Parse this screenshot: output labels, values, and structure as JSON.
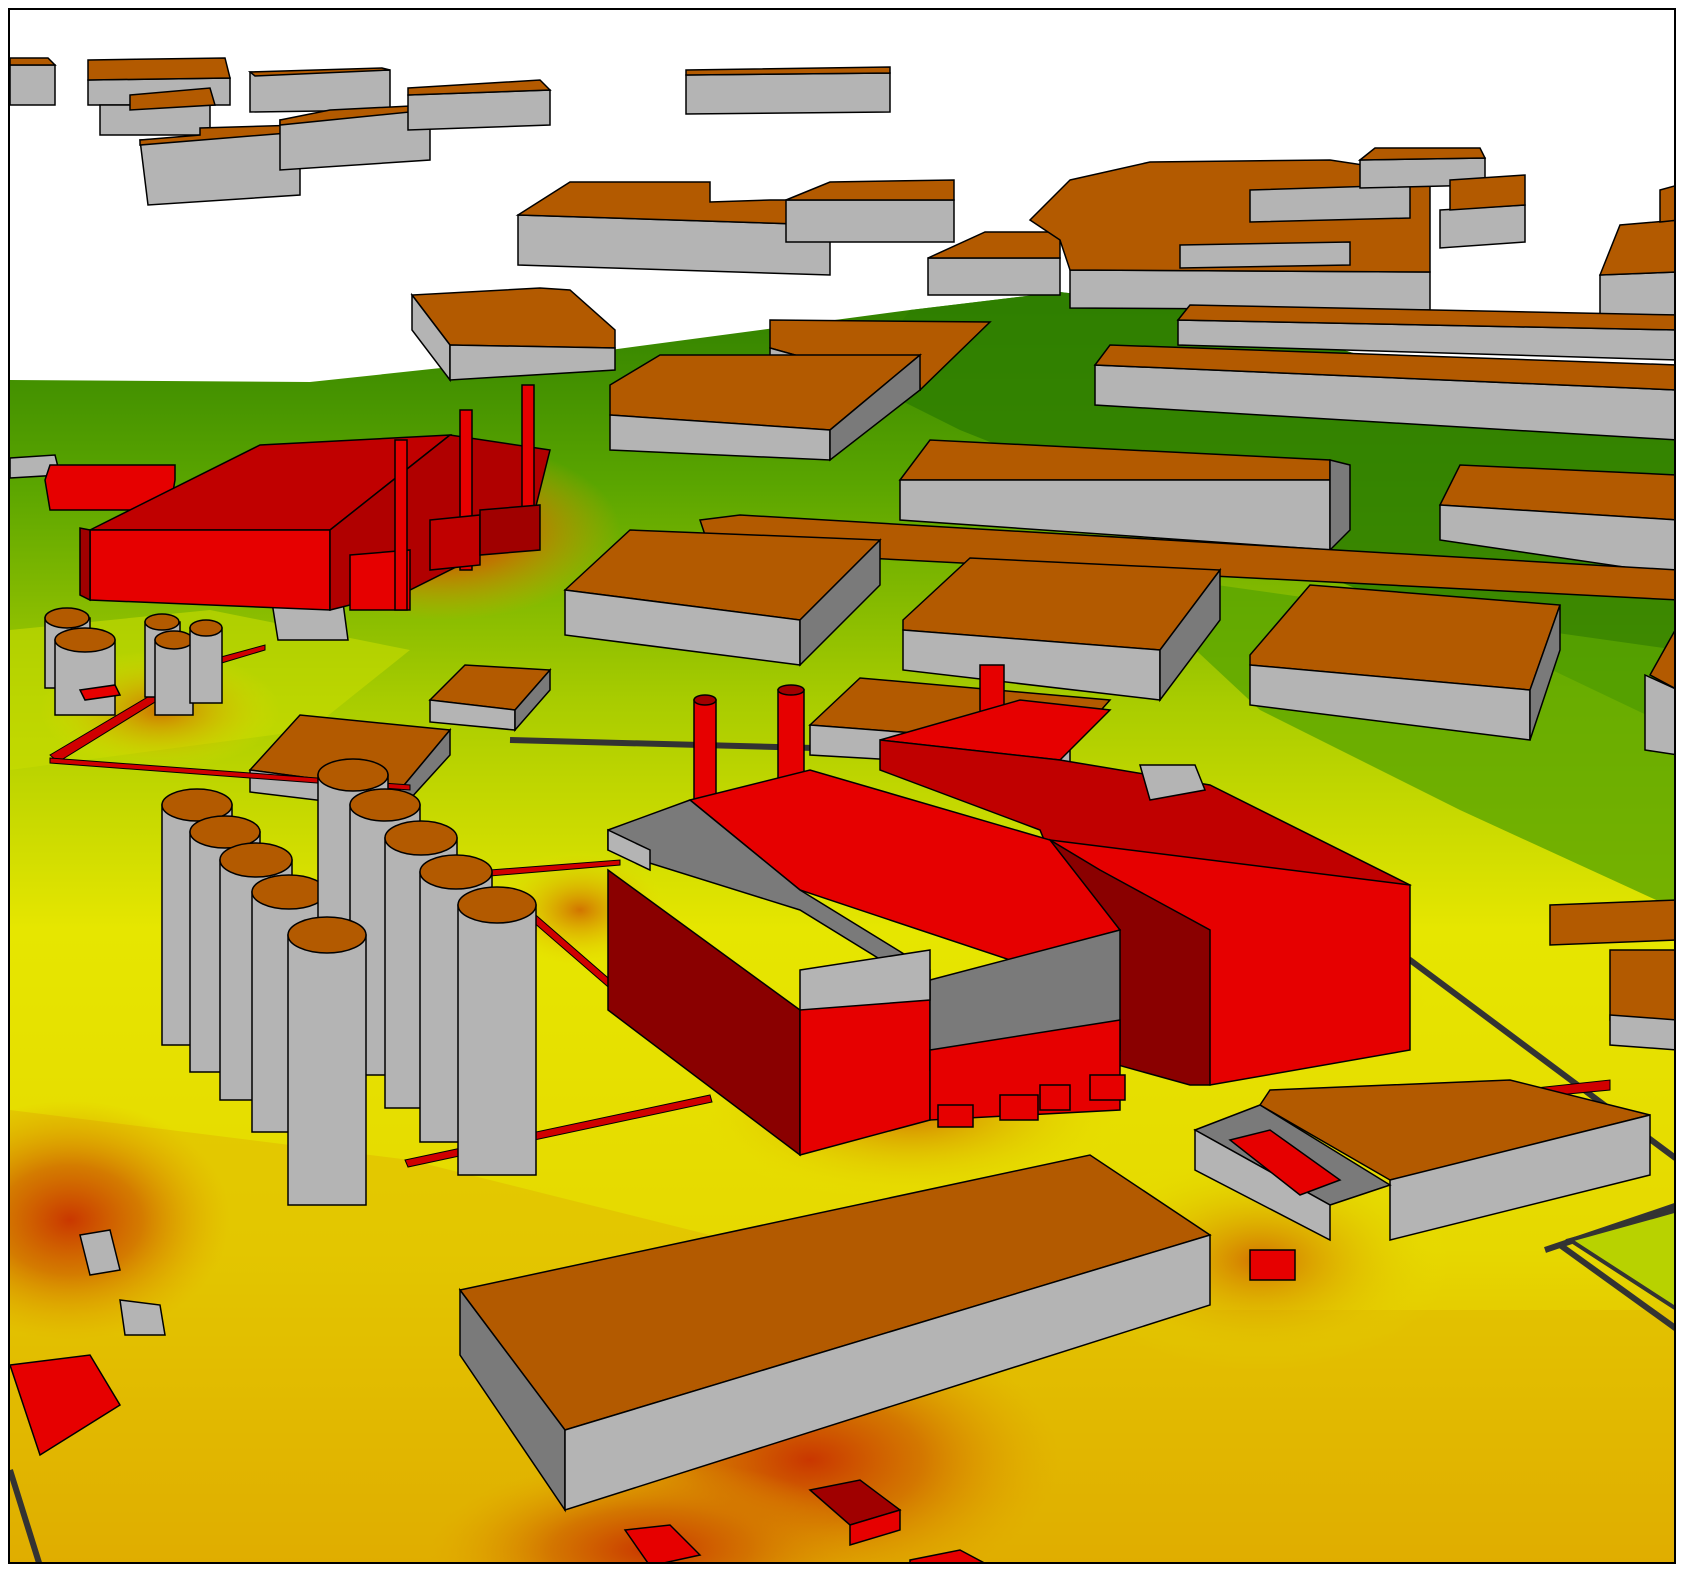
{
  "scene": {
    "view": "3d-perspective-noise-map",
    "colors": {
      "roof_neutral": "#b35a00",
      "wall_light": "#b4b4b4",
      "wall_dark": "#7a7a7a",
      "source_red": "#e60000",
      "source_red_dark": "#a00000",
      "level_green_dark": "#2f7f00",
      "level_green": "#5aa500",
      "level_yellow_green": "#b8d200",
      "level_yellow": "#e6e600",
      "level_orange": "#e0a000",
      "level_orange_dark": "#d06800",
      "level_red": "#c83000",
      "outline": "#000000"
    },
    "legend": [],
    "labels": []
  }
}
